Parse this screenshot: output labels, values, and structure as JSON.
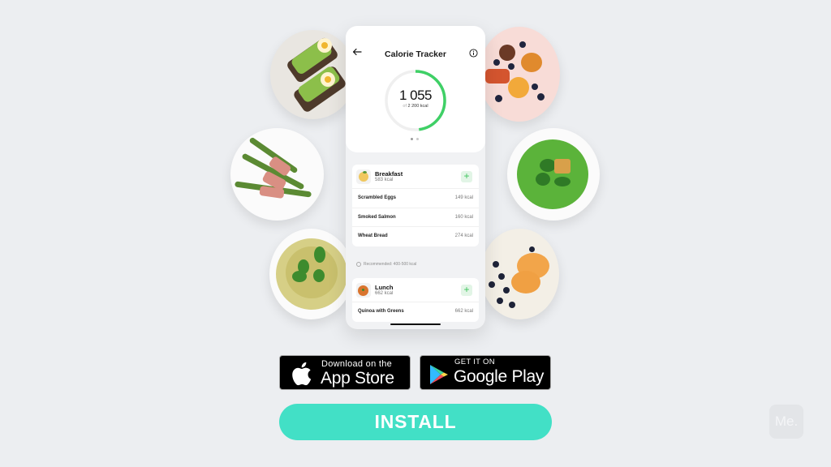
{
  "app": {
    "title": "Calorie Tracker",
    "back_icon": "arrow-left-icon",
    "info_icon": "info-circle-icon"
  },
  "summary": {
    "consumed": "1 055",
    "of_label": "of",
    "goal": "2 200 kcal",
    "progress_fraction": 0.48,
    "accent_color": "#3fd066",
    "page_dots": 2,
    "active_dot": 0
  },
  "meals": [
    {
      "name": "Breakfast",
      "kcal": "583 kcal",
      "add_label": "+",
      "items": [
        {
          "name": "Scrambled Eggs",
          "kcal": "149 kcal"
        },
        {
          "name": "Smoked Salmon",
          "kcal": "160 kcal"
        },
        {
          "name": "Wheat Bread",
          "kcal": "274 kcal"
        }
      ]
    },
    {
      "name": "Lunch",
      "kcal": "662 kcal",
      "add_label": "+",
      "items": [
        {
          "name": "Quinoa with Greens",
          "kcal": "662 kcal"
        }
      ]
    }
  ],
  "recommendation": "Recommended: 400-500 kcal",
  "stores": {
    "apple": {
      "small": "Download on the",
      "big": "App Store",
      "icon": "apple-logo-icon"
    },
    "google": {
      "small": "GET IT ON",
      "big": "Google Play",
      "icon": "google-play-icon"
    }
  },
  "cta": {
    "install_label": "INSTALL",
    "color": "#42e0c6"
  },
  "watermark": {
    "label": "Me."
  },
  "plates": [
    "avocado-toast-plate",
    "asparagus-bacon-plate",
    "pesto-pasta-plate",
    "tomato-blueberry-plate",
    "green-soup-plate",
    "oatmeal-peach-plate"
  ]
}
